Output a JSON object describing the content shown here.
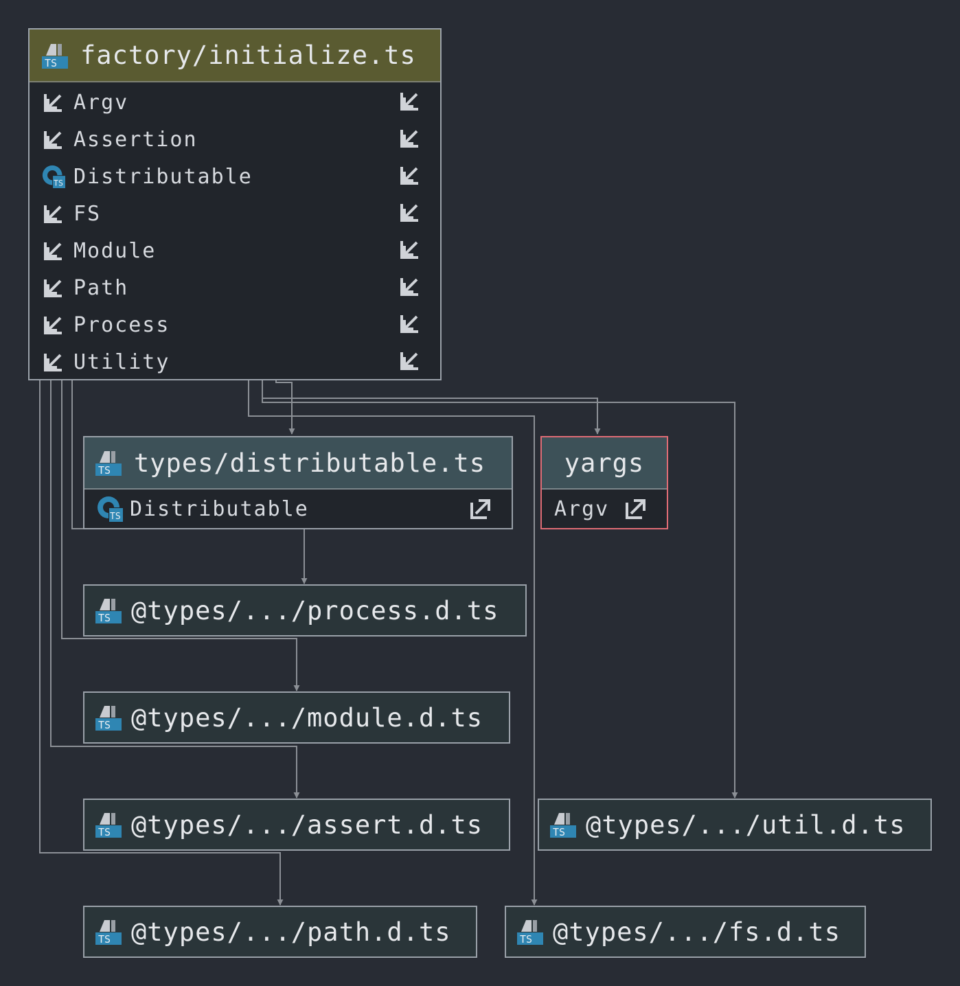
{
  "main_node": {
    "title": "factory/initialize.ts",
    "header_color": "#5a5b31",
    "items": [
      {
        "label": "Argv",
        "icon": "import-arrow-icon"
      },
      {
        "label": "Assertion",
        "icon": "import-arrow-icon"
      },
      {
        "label": "Distributable",
        "icon": "ts-type-icon"
      },
      {
        "label": "FS",
        "icon": "import-arrow-icon"
      },
      {
        "label": "Module",
        "icon": "import-arrow-icon"
      },
      {
        "label": "Path",
        "icon": "import-arrow-icon"
      },
      {
        "label": "Process",
        "icon": "import-arrow-icon"
      },
      {
        "label": "Utility",
        "icon": "import-arrow-icon"
      }
    ]
  },
  "dist_node": {
    "title": "types/distributable.ts",
    "item": "Distributable",
    "header_color": "#3d5158"
  },
  "yargs_node": {
    "title": "yargs",
    "item": "Argv",
    "border_color": "#e06c75"
  },
  "process_node": {
    "title": "@types/.../process.d.ts"
  },
  "module_node": {
    "title": "@types/.../module.d.ts"
  },
  "assert_node": {
    "title": "@types/.../assert.d.ts"
  },
  "util_node": {
    "title": "@types/.../util.d.ts"
  },
  "path_node": {
    "title": "@types/.../path.d.ts"
  },
  "fs_node": {
    "title": "@types/.../fs.d.ts"
  },
  "colors": {
    "background": "#282c34",
    "edge": "#8c9096",
    "file_node_bg": "#2a3539",
    "ts_badge": "#2f86b3"
  }
}
